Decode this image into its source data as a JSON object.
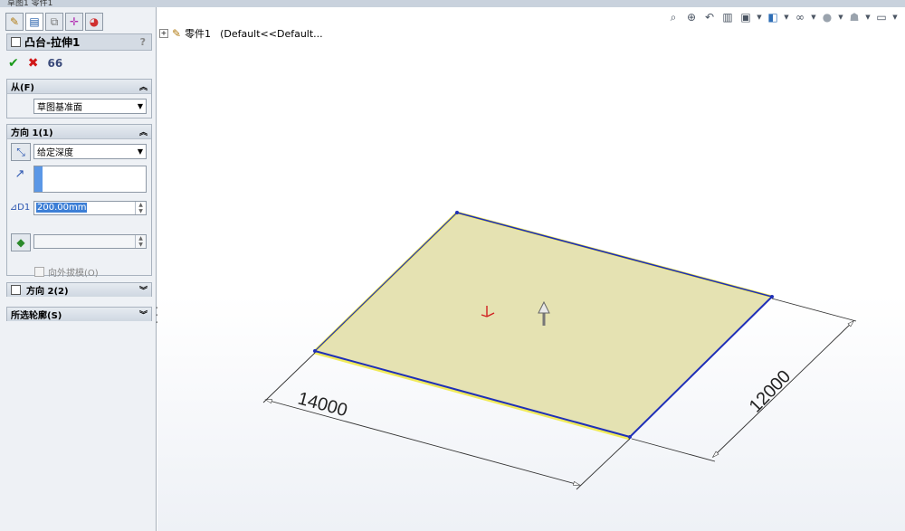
{
  "window": {
    "title": "草图1  零件1"
  },
  "property_manager": {
    "feature_title": "凸台-拉伸1",
    "help": "?",
    "ok": "✔",
    "cancel": "✖",
    "from": {
      "header": "从(F)",
      "value": "草图基准面"
    },
    "direction1": {
      "header": "方向 1(1)",
      "end_condition": "给定深度",
      "depth": "200.00mm",
      "draft_outward": "向外拔模(O)"
    },
    "direction2": {
      "header": "方向 2(2)"
    },
    "selected_contours": {
      "header": "所选轮廓(S)"
    }
  },
  "tree": {
    "part_name": "零件1",
    "config": "(Default<<Default..."
  },
  "chart_data": {
    "type": "diagram",
    "dimensions": [
      {
        "value": "14000"
      },
      {
        "value": "12000"
      }
    ]
  },
  "colors": {
    "face": "#e2dfaa",
    "edge_selected": "#1f2fb8",
    "edge_highlight": "#f0ea5a",
    "dim_line": "#333333"
  }
}
